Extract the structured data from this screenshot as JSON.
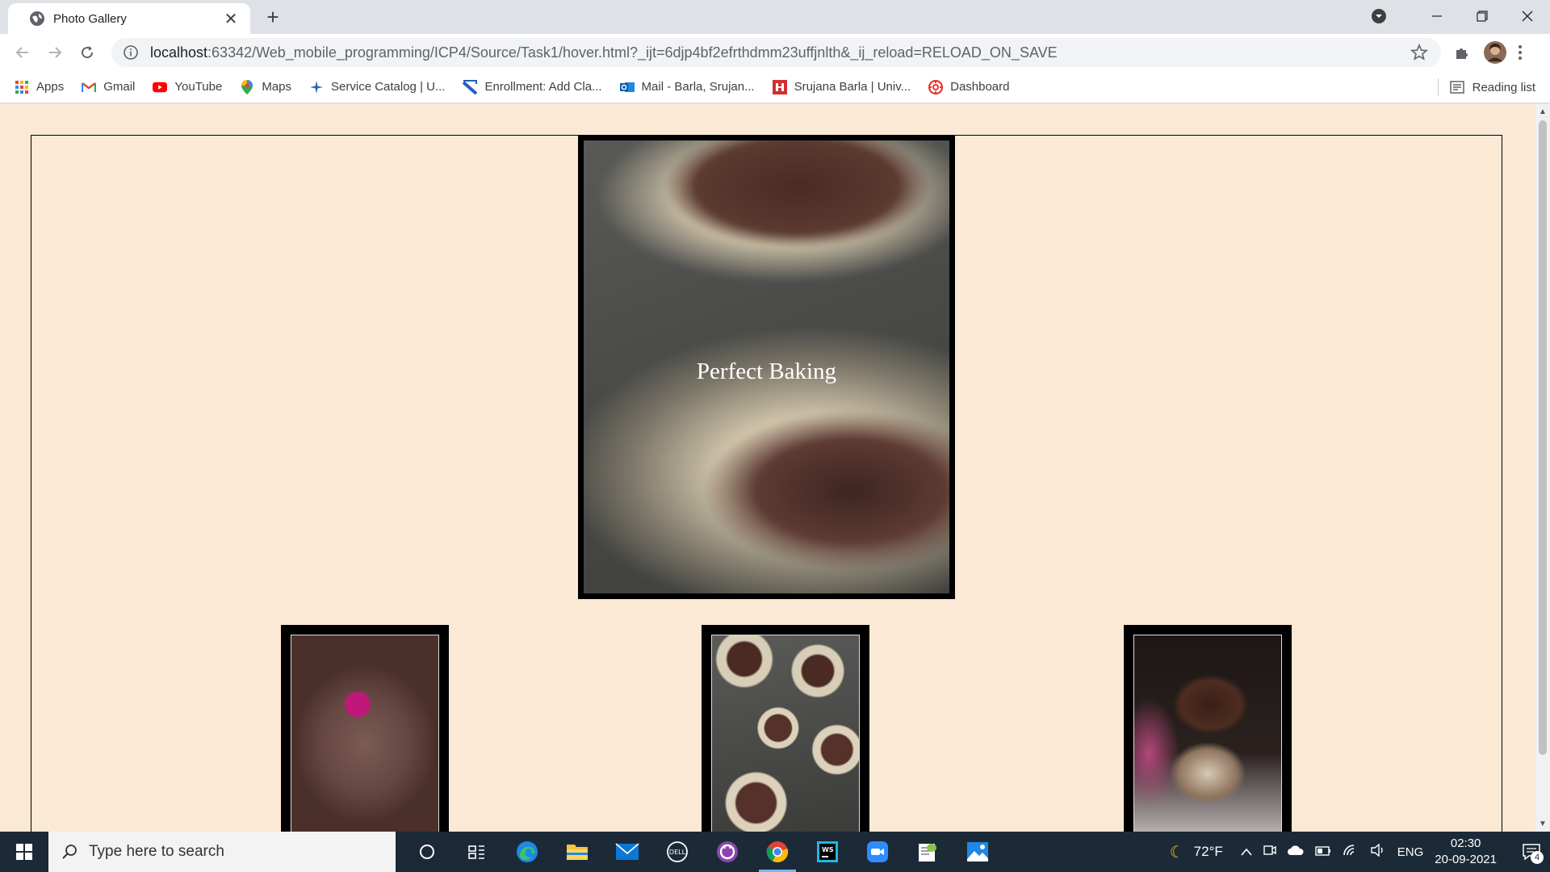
{
  "browser": {
    "tab_title": "Photo Gallery",
    "new_tab_label": "+",
    "close_tab_label": "✕",
    "url_host": "localhost",
    "url_rest": ":63342/Web_mobile_programming/ICP4/Source/Task1/hover.html?_ijt=6djp4bf2efrthdmm23uffjnlth&_ij_reload=RELOAD_ON_SAVE"
  },
  "bookmarks": [
    {
      "label": "Apps",
      "icon": "apps-grid-icon"
    },
    {
      "label": "Gmail",
      "icon": "gmail-icon"
    },
    {
      "label": "YouTube",
      "icon": "youtube-icon"
    },
    {
      "label": "Maps",
      "icon": "maps-pin-icon"
    },
    {
      "label": "Service Catalog | U...",
      "icon": "service-catalog-icon"
    },
    {
      "label": "Enrollment: Add Cla...",
      "icon": "enrollment-icon"
    },
    {
      "label": "Mail - Barla, Srujan...",
      "icon": "outlook-icon"
    },
    {
      "label": "Srujana Barla | Univ...",
      "icon": "university-icon"
    },
    {
      "label": "Dashboard",
      "icon": "dashboard-icon"
    }
  ],
  "reading_list": "Reading list",
  "page": {
    "featured_caption": "Perfect Baking"
  },
  "taskbar": {
    "search_placeholder": "Type here to search",
    "temperature": "72°F",
    "language": "ENG",
    "time": "02:30",
    "date": "20-09-2021",
    "notification_count": "4"
  },
  "colors": {
    "page_background": "#fbe9d6",
    "taskbar": "#1c2a38",
    "tab_strip": "#dee1e6"
  }
}
